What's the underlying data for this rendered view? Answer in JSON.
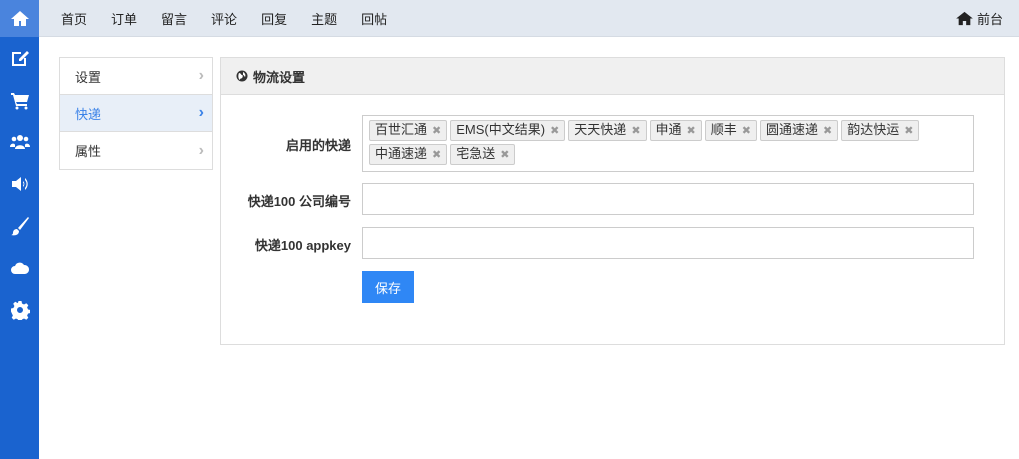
{
  "sidebar": [
    "home-icon",
    "edit-icon",
    "cart-icon",
    "users-icon",
    "volume-icon",
    "brush-icon",
    "cloud-icon",
    "gear-icon"
  ],
  "topnav": {
    "items": [
      "首页",
      "订单",
      "留言",
      "评论",
      "回复",
      "主题",
      "回帖"
    ],
    "front": "前台"
  },
  "menu": [
    {
      "label": "设置",
      "active": false
    },
    {
      "label": "快递",
      "active": true
    },
    {
      "label": "属性",
      "active": false
    }
  ],
  "panel": {
    "title": "物流设置",
    "enabled_label": "启用的快递",
    "tags": [
      "百世汇通",
      "EMS(中文结果)",
      "天天快递",
      "申通",
      "顺丰",
      "圆通速递",
      "韵达快运",
      "中通速递",
      "宅急送"
    ],
    "company_label": "快递100 公司编号",
    "company_value": "",
    "appkey_label": "快递100 appkey",
    "appkey_value": "",
    "save": "保存"
  }
}
